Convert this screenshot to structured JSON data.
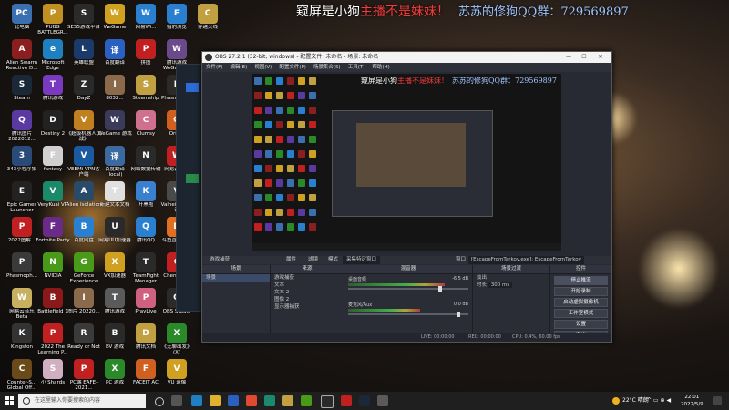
{
  "overlay": {
    "part1": "窥屏是小狗",
    "part2": "主播不是妹妹！",
    "qq": "苏苏的修狗QQ群：729569897"
  },
  "desktop_icons": [
    {
      "label": "此电脑",
      "color": "#3a6fb0",
      "glyph": "PC"
    },
    {
      "label": "Alien Swarm Reactive D...",
      "color": "#8b1e1e",
      "glyph": "A"
    },
    {
      "label": "Steam",
      "color": "#1b2838",
      "glyph": "S"
    },
    {
      "label": "腾讯图片 2022012...",
      "color": "#5a3aa0",
      "glyph": "Q"
    },
    {
      "label": "343小程序集",
      "color": "#2a4a7a",
      "glyph": "3"
    },
    {
      "label": "Epic Games Launcher",
      "color": "#222",
      "glyph": "E"
    },
    {
      "label": "2022图解...",
      "color": "#c02020",
      "glyph": "P"
    },
    {
      "label": "Phasmoph...",
      "color": "#3a3a3a",
      "glyph": "P"
    },
    {
      "label": "网易云音乐 Beta",
      "color": "#c8b060",
      "glyph": "W"
    },
    {
      "label": "Kingston",
      "color": "#333",
      "glyph": "K"
    },
    {
      "label": "Counter-S... Global Off...",
      "color": "#6b4a1a",
      "glyph": "C"
    },
    {
      "label": "PUBG BATTLEGR...",
      "color": "#c09020",
      "glyph": "P"
    },
    {
      "label": "Microsoft Edge",
      "color": "#1e80c0",
      "glyph": "e"
    },
    {
      "label": "腾讯游戏",
      "color": "#7a3ac0",
      "glyph": "T"
    },
    {
      "label": "Destiny 2",
      "color": "#222",
      "glyph": "D"
    },
    {
      "label": "fantasy",
      "color": "#d0d0d0",
      "glyph": "F"
    },
    {
      "label": "VeryKuai VR",
      "color": "#1a8a6a",
      "glyph": "V"
    },
    {
      "label": "Fortnite Party",
      "color": "#6a2a8a",
      "glyph": "F"
    },
    {
      "label": "NVIDIA",
      "color": "#4a9a1a",
      "glyph": "N"
    },
    {
      "label": "Battlefield 1",
      "color": "#8a1a1a",
      "glyph": "B"
    },
    {
      "label": "2022 The Learning P...",
      "color": "#c02020",
      "glyph": "P"
    },
    {
      "label": "小 Shards",
      "color": "#d0b0c0",
      "glyph": "S"
    },
    {
      "label": "SE55游戏平台",
      "color": "#2a2a2a",
      "glyph": "S"
    },
    {
      "label": "英雄联盟",
      "color": "#1a3a6a",
      "glyph": "L"
    },
    {
      "label": "DayZ",
      "color": "#2a2a2a",
      "glyph": "Z"
    },
    {
      "label": "《超级机器人大战》",
      "color": "#c08020",
      "glyph": "V"
    },
    {
      "label": "VEEMi VPN客户端",
      "color": "#1a5aa0",
      "glyph": "V"
    },
    {
      "label": "Alien Isolation",
      "color": "#2a4a6a",
      "glyph": "A"
    },
    {
      "label": "百度网盘",
      "color": "#2a80d0",
      "glyph": "B"
    },
    {
      "label": "GeForce Experience",
      "color": "#4a9a1a",
      "glyph": "G"
    },
    {
      "label": "图片 20220...",
      "color": "#8a6a4a",
      "glyph": "I"
    },
    {
      "label": "Ready or Not",
      "color": "#3a3a3a",
      "glyph": "R"
    },
    {
      "label": "PC端 EAFE-2021...",
      "color": "#c02020",
      "glyph": "P"
    },
    {
      "label": "WeGame",
      "color": "#d0a020",
      "glyph": "W"
    },
    {
      "label": "百度翻译",
      "color": "#2a60c0",
      "glyph": "译"
    },
    {
      "label": "8032...",
      "color": "#8a6a4a",
      "glyph": "I"
    },
    {
      "label": "WeGame 游戏",
      "color": "#3a3a5a",
      "glyph": "W"
    },
    {
      "label": "百度翻译 (local)",
      "color": "#3a6aa0",
      "glyph": "译"
    },
    {
      "label": "新建文本文档",
      "color": "#e0e0e0",
      "glyph": "T"
    },
    {
      "label": "网易UU加速器",
      "color": "#2a2a2a",
      "glyph": "U"
    },
    {
      "label": "VX加速器",
      "color": "#d0a020",
      "glyph": "X"
    },
    {
      "label": "腾讯游戏",
      "color": "#5a5a5a",
      "glyph": "T"
    },
    {
      "label": "BV 游戏",
      "color": "#2a2a2a",
      "glyph": "B"
    },
    {
      "label": "PC 游戏",
      "color": "#2a8a2a",
      "glyph": "X"
    },
    {
      "label": "网易Wi...",
      "color": "#2a80d0",
      "glyph": "W"
    },
    {
      "label": "拼图",
      "color": "#c02020",
      "glyph": "P"
    },
    {
      "label": "Steamship",
      "color": "#c0a040",
      "glyph": "S"
    },
    {
      "label": "Clumsy",
      "color": "#d07090",
      "glyph": "C"
    },
    {
      "label": "网络数据传输",
      "color": "#2a2a2a",
      "glyph": "N"
    },
    {
      "label": "开黑啦",
      "color": "#3a80d0",
      "glyph": "K"
    },
    {
      "label": "腾讯QQ",
      "color": "#2a80d0",
      "glyph": "Q"
    },
    {
      "label": "TeamFight Manager",
      "color": "#2a2a2a",
      "glyph": "T"
    },
    {
      "label": "PrayLive",
      "color": "#d06080",
      "glyph": "P"
    },
    {
      "label": "腾讯文档",
      "color": "#c0a040",
      "glyph": "D"
    },
    {
      "label": "FACEIT AC",
      "color": "#d06020",
      "glyph": "F"
    },
    {
      "label": "猎豹浏览",
      "color": "#2a80d0",
      "glyph": "F"
    },
    {
      "label": "腾讯游戏 WeGame版",
      "color": "#6a4a8a",
      "glyph": "W"
    },
    {
      "label": "Phasmoph...",
      "color": "#2a2a2a",
      "glyph": "P"
    },
    {
      "label": "Origin",
      "color": "#d06020",
      "glyph": "O"
    },
    {
      "label": "网易云音乐",
      "color": "#c02020",
      "glyph": "W"
    },
    {
      "label": "Valheim 苏苏试",
      "color": "#4a4a4a",
      "glyph": "V"
    },
    {
      "label": "斗鱼直播伴侣",
      "color": "#e07020",
      "glyph": "D"
    },
    {
      "label": "Cherry助手",
      "color": "#c02020",
      "glyph": "C"
    },
    {
      "label": "OBS Studio",
      "color": "#2a2a2a",
      "glyph": "O"
    },
    {
      "label": "《无聊出发》 (X)",
      "color": "#2a8a2a",
      "glyph": "X"
    },
    {
      "label": "VU 录像",
      "color": "#d0a020",
      "glyph": "V"
    },
    {
      "label": "穿越火线",
      "color": "#c0a040",
      "glyph": "C"
    }
  ],
  "obs": {
    "title": "OBS 27.2.1 (32-bit, windows) - 配置文件: 未命名 - 场景: 未命名",
    "window_controls": [
      "—",
      "☐",
      "✕"
    ],
    "menu": [
      "文件(F)",
      "编辑(E)",
      "视图(V)",
      "配置文件(P)",
      "场景集合(S)",
      "工具(T)",
      "帮助(H)"
    ],
    "source_bar": {
      "selected": "游戏捕获",
      "properties": "属性",
      "filters": "滤镜",
      "mode_label": "模式",
      "mode_value": "采集特定窗口",
      "window_label": "窗口",
      "window_value": "[EscapeFromTarkov.exe]: EscapeFromTarkov"
    },
    "docks": {
      "scenes": {
        "title": "场景",
        "items": [
          "场景"
        ]
      },
      "sources": {
        "title": "来源",
        "items": [
          "游戏捕获",
          "文本",
          "文本 2",
          "图像 2",
          "显示器捕获"
        ]
      },
      "mixer": {
        "title": "混音器",
        "channels": [
          {
            "name": "桌面音频",
            "value": "-6.5 dB"
          },
          {
            "name": "麦克风/Aux",
            "value": "0.0 dB"
          }
        ]
      },
      "transitions": {
        "title": "场景过渡",
        "type": "淡出",
        "duration_label": "时长",
        "duration": "300 ms"
      },
      "controls": {
        "title": "控件",
        "buttons": [
          "停止推流",
          "开始录制",
          "启动虚拟摄像机",
          "工作室模式",
          "设置",
          "退出"
        ]
      }
    },
    "status": {
      "live": "LIVE: 00:00:00",
      "rec": "REC: 00:00:00",
      "cpu": "CPU: 0.4%, 60.00 fps"
    }
  },
  "taskbar": {
    "search_placeholder": "在这里输入你要搜索的内容",
    "weather": "22°C 晴朗",
    "time": "22:01",
    "date": "2022/5/9"
  }
}
